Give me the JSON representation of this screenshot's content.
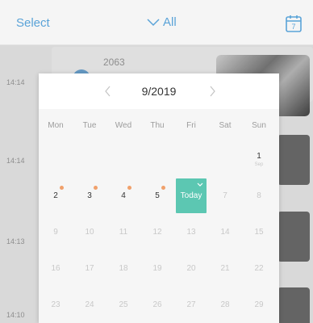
{
  "topbar": {
    "select_label": "Select",
    "filter_label": "All",
    "calendar_icon_day": "7"
  },
  "list": {
    "times": [
      "14:14",
      "14:14",
      "14:13",
      "14:10"
    ],
    "year": "2063"
  },
  "calendar": {
    "month_label": "9/2019",
    "weekdays": [
      "Mon",
      "Tue",
      "Wed",
      "Thu",
      "Fri",
      "Sat",
      "Sun"
    ],
    "today_label": "Today",
    "sun1_sub": "Sep",
    "colors": {
      "accent": "#5aa3d8",
      "today": "#5cc7b2",
      "dot": "#f0a06b"
    },
    "days": [
      [
        "",
        "",
        "",
        "",
        "",
        "",
        "1"
      ],
      [
        "2",
        "3",
        "4",
        "5",
        "Today",
        "7",
        "8"
      ],
      [
        "9",
        "10",
        "11",
        "12",
        "13",
        "14",
        "15"
      ],
      [
        "16",
        "17",
        "18",
        "19",
        "20",
        "21",
        "22"
      ],
      [
        "23",
        "24",
        "25",
        "26",
        "27",
        "28",
        "29"
      ]
    ]
  }
}
